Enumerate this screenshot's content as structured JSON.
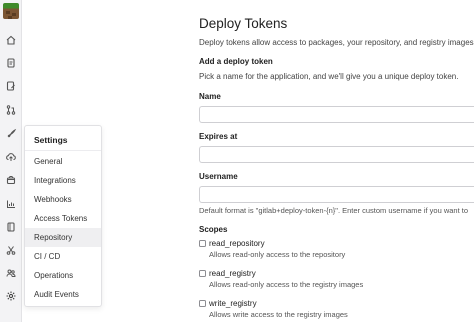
{
  "rail": {
    "icons": [
      "project-avatar",
      "home-icon",
      "document-icon",
      "issues-icon",
      "merge-request-icon",
      "rocket-icon",
      "cloud-upload-icon",
      "package-icon",
      "analytics-icon",
      "wiki-icon",
      "snippets-icon",
      "members-icon",
      "settings-icon"
    ]
  },
  "settings_menu": {
    "title": "Settings",
    "items": [
      {
        "label": "General"
      },
      {
        "label": "Integrations"
      },
      {
        "label": "Webhooks"
      },
      {
        "label": "Access Tokens"
      },
      {
        "label": "Repository"
      },
      {
        "label": "CI / CD"
      },
      {
        "label": "Operations"
      },
      {
        "label": "Audit Events"
      }
    ],
    "active_item": "Repository"
  },
  "main": {
    "title": "Deploy Tokens",
    "description": "Deploy tokens allow access to packages, your repository, and registry images.",
    "add_section": {
      "title": "Add a deploy token",
      "description": "Pick a name for the application, and we'll give you a unique deploy token."
    },
    "fields": {
      "name_label": "Name",
      "name_value": "",
      "expires_label": "Expires at",
      "expires_value": "",
      "username_label": "Username",
      "username_value": "",
      "username_help": "Default format is \"gitlab+deploy-token-{n}\". Enter custom username if you want to"
    },
    "scopes": {
      "label": "Scopes",
      "items": [
        {
          "name": "read_repository",
          "description": "Allows read-only access to the repository",
          "checked": false
        },
        {
          "name": "read_registry",
          "description": "Allows read-only access to the registry images",
          "checked": false
        },
        {
          "name": "write_registry",
          "description": "Allows write access to the registry images",
          "checked": false
        }
      ]
    }
  }
}
